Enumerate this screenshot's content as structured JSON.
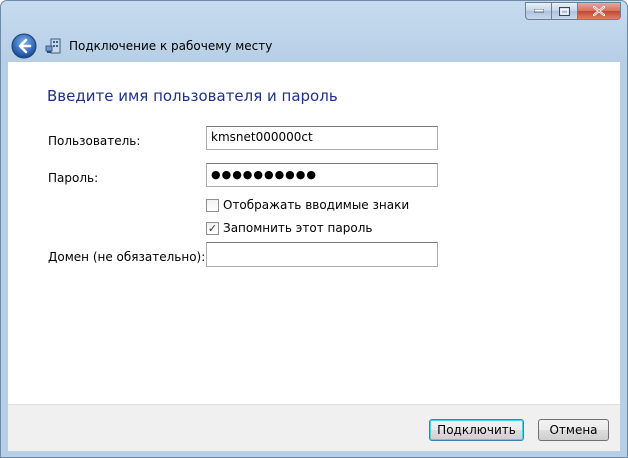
{
  "window": {
    "title": "Подключение к рабочему месту",
    "caption_buttons": [
      "minimize-icon",
      "maximize-icon",
      "close-icon"
    ]
  },
  "form": {
    "heading": "Введите имя пользователя и пароль",
    "username_label": "Пользователь:",
    "username_value": "kmsnet000000ct",
    "password_label": "Пароль:",
    "password_value": "●●●●●●●●●●",
    "show_chars_label": "Отображать вводимые знаки",
    "show_chars_checked": false,
    "remember_label": "Запомнить этот пароль",
    "remember_checked": true,
    "remember_mark": "✓",
    "domain_label": "Домен (не обязательно):",
    "domain_value": ""
  },
  "footer": {
    "connect_label": "Подключить",
    "cancel_label": "Отмена"
  }
}
